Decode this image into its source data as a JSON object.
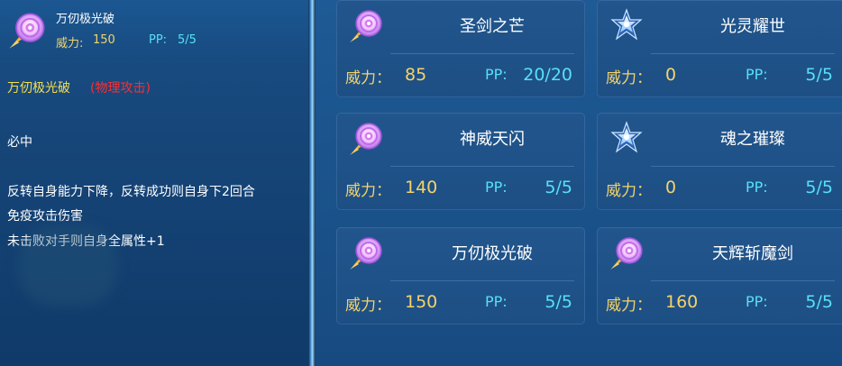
{
  "colors": {
    "power": "#f4d36a",
    "pp": "#58e0f4",
    "title_yellow": "#f4e04c",
    "tag_red": "#ff2d2d"
  },
  "left": {
    "header": {
      "icon": "disc-icon",
      "name": "万仞极光破",
      "power_label": "威力:",
      "power_value": "150",
      "pp_label": "PP:",
      "pp_value": "5/5"
    },
    "desc_title": "万仞极光破",
    "desc_tag": "(物理攻击)",
    "desc_lines": [
      "必中",
      "反转自身能力下降，反转成功则自身下2回合",
      "免疫攻击伤害",
      "未击败对手则自身全属性+1"
    ]
  },
  "skills": [
    {
      "name": "圣剑之芒",
      "icon": "disc-icon",
      "power_label": "威力：",
      "power": "85",
      "pp_label": "PP:",
      "pp": "20/20"
    },
    {
      "name": "光灵耀世",
      "icon": "star-icon",
      "power_label": "威力：",
      "power": "0",
      "pp_label": "PP:",
      "pp": "5/5"
    },
    {
      "name": "神威天闪",
      "icon": "disc-icon",
      "power_label": "威力：",
      "power": "140",
      "pp_label": "PP:",
      "pp": "5/5"
    },
    {
      "name": "魂之璀璨",
      "icon": "star-icon",
      "power_label": "威力：",
      "power": "0",
      "pp_label": "PP:",
      "pp": "5/5"
    },
    {
      "name": "万仞极光破",
      "icon": "disc-icon",
      "power_label": "威力：",
      "power": "150",
      "pp_label": "PP:",
      "pp": "5/5"
    },
    {
      "name": "天辉斩魔剑",
      "icon": "disc-icon",
      "power_label": "威力：",
      "power": "160",
      "pp_label": "PP:",
      "pp": "5/5"
    }
  ]
}
